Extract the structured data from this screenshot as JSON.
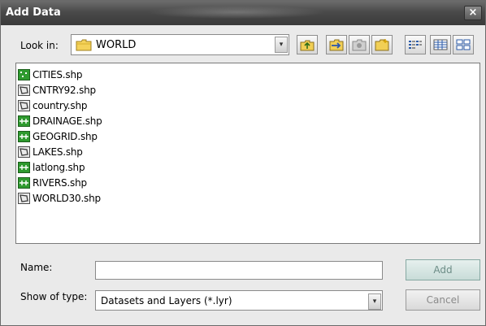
{
  "window": {
    "title": "Add Data",
    "close_glyph": "×"
  },
  "lookin": {
    "label": "Look in:",
    "value": "WORLD",
    "folder_icon": "folder-icon"
  },
  "toolbar": {
    "up_one_level": "up-one-level-icon",
    "connect_folder": "connect-to-folder-icon",
    "disconnect_folder": "disconnect-folder-icon",
    "new_folder": "new-folder-icon",
    "list_view": "list-view-icon",
    "details_view": "details-view-icon",
    "thumbnails_view": "thumbnails-view-icon"
  },
  "files": [
    {
      "name": "CITIES.shp",
      "type": "point"
    },
    {
      "name": "CNTRY92.shp",
      "type": "polygon"
    },
    {
      "name": "country.shp",
      "type": "polygon"
    },
    {
      "name": "DRAINAGE.shp",
      "type": "line"
    },
    {
      "name": "GEOGRID.shp",
      "type": "line"
    },
    {
      "name": "LAKES.shp",
      "type": "polygon"
    },
    {
      "name": "latlong.shp",
      "type": "line"
    },
    {
      "name": "RIVERS.shp",
      "type": "line"
    },
    {
      "name": "WORLD30.shp",
      "type": "polygon"
    }
  ],
  "name_field": {
    "label": "Name:",
    "value": ""
  },
  "type_field": {
    "label": "Show of type:",
    "value": "Datasets and Layers (*.lyr)"
  },
  "buttons": {
    "add": "Add",
    "cancel": "Cancel"
  },
  "colors": {
    "titlebar": "#4a4a4a",
    "dialog_bg": "#eaeaea",
    "shapefile_icon": "#2e9a2e"
  }
}
